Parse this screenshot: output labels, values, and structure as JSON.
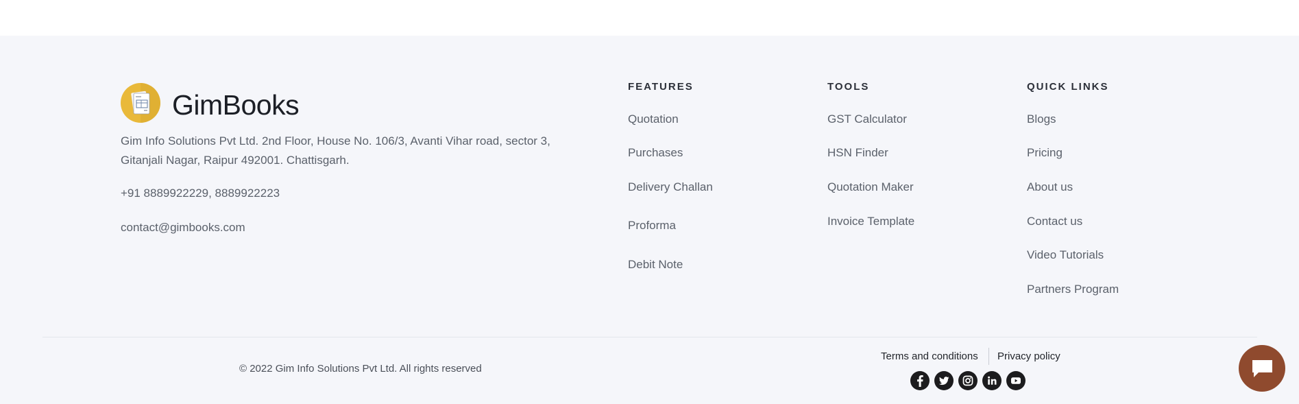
{
  "brand": {
    "name": "GimBooks",
    "logo_icon": "invoice-document-icon",
    "address": "Gim Info Solutions Pvt Ltd. 2nd Floor, House No. 106/3, Avanti Vihar road, sector 3, Gitanjali Nagar, Raipur 492001. Chattisgarh.",
    "phone": "+91 8889922229, 8889922223",
    "email": "contact@gimbooks.com"
  },
  "features": {
    "heading": "FEATURES",
    "links": [
      "Quotation",
      "Purchases",
      "Delivery Challan",
      "Proforma",
      "Debit Note"
    ]
  },
  "tools": {
    "heading": "TOOLS",
    "links": [
      "GST Calculator",
      "HSN Finder",
      "Quotation Maker",
      "Invoice Template"
    ]
  },
  "quick_links": {
    "heading": "QUICK LINKS",
    "links": [
      "Blogs",
      "Pricing",
      "About us",
      "Contact us",
      "Video Tutorials",
      "Partners Program"
    ]
  },
  "bottom": {
    "copyright": "© 2022 Gim Info Solutions Pvt Ltd. All rights reserved",
    "terms": "Terms and conditions",
    "privacy": "Privacy policy",
    "social": [
      "facebook-icon",
      "twitter-icon",
      "instagram-icon",
      "linkedin-icon",
      "youtube-icon"
    ]
  },
  "chat": {
    "icon": "chat-bubble-icon",
    "color": "#8f4a2e"
  },
  "colors": {
    "footer_bg": "#f5f6fa",
    "logo_bg": "#e9b93a"
  }
}
